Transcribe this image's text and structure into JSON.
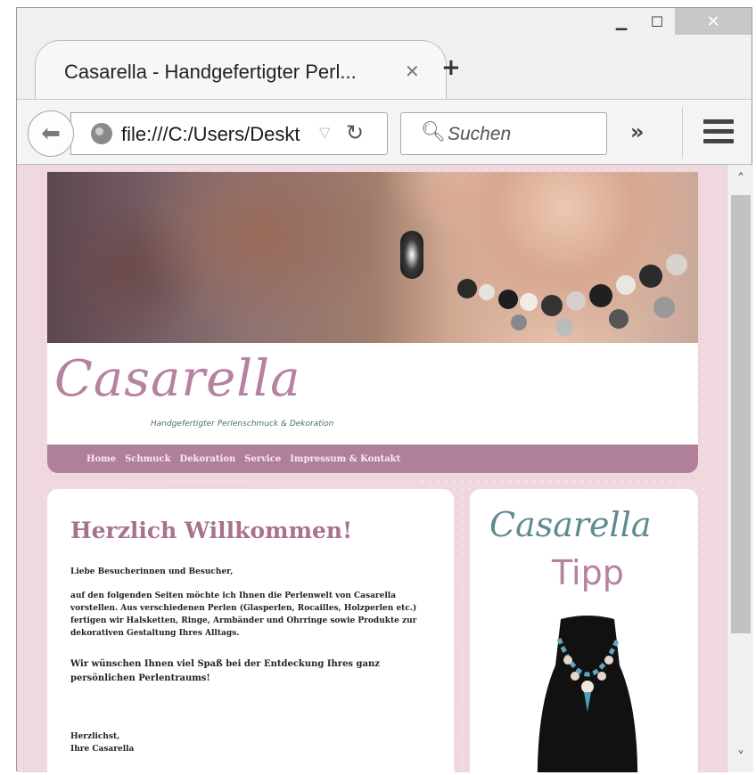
{
  "browser": {
    "tab_title": "Casarella - Handgefertigter Perl...",
    "tab_close": "✕",
    "new_tab": "+",
    "url": "file:///C:/Users/Deskt",
    "search_placeholder": "Suchen",
    "overflow": "»",
    "window_buttons": {
      "minimize": "▁",
      "maximize": "☐",
      "close": "✕"
    }
  },
  "site": {
    "logo": "Casarella",
    "tagline": "Handgefertigter Perlenschmuck & Dekoration",
    "nav": [
      "Home",
      "Schmuck",
      "Dekoration",
      "Service",
      "Impressum & Kontakt"
    ],
    "welcome": {
      "title": "Herzlich Willkommen!",
      "greeting": "Liebe Besucherinnen und Besucher,",
      "intro": "auf den folgenden Seiten möchte ich Ihnen die Perlenwelt von Casarella vorstellen. Aus verschiedenen Perlen (Glasperlen, Rocailles, Holzperlen etc.) fertigen wir Halsketten, Ringe, Armbänder und Ohrringe sowie Produkte zur dekorativen Gestaltung Ihres Alltags.",
      "wish": "Wir wünschen Ihnen viel Spaß bei der Entdeckung Ihres ganz persönlichen Perlentraums!",
      "closing_1": "Herzlichst,",
      "closing_2": "Ihre Casarella"
    },
    "tipp": {
      "brand": "Casarella",
      "label": "Tipp"
    }
  },
  "colors": {
    "accent": "#b0809a",
    "title": "#a8728f",
    "teal": "#5f8a90",
    "background": "#efd7de"
  }
}
